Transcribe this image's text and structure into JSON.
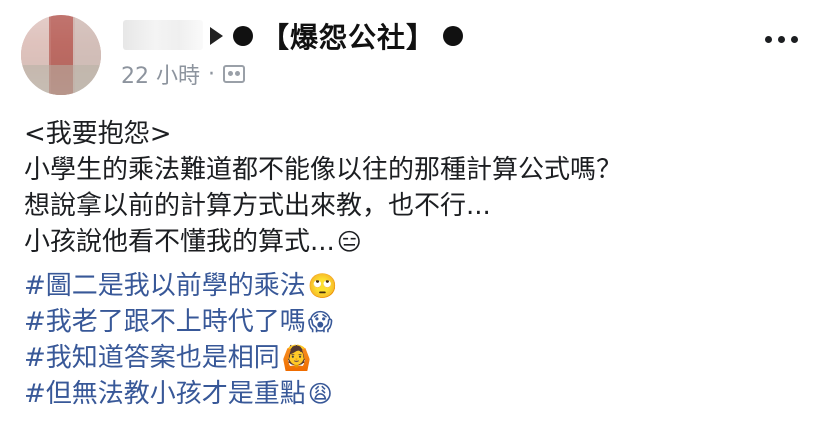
{
  "post": {
    "group_name": "【爆怨公社】",
    "time": "22 小時",
    "separator": "·",
    "privacy_icon": "friends-icon",
    "more_icon": "more-options-icon"
  },
  "content": {
    "lines": [
      "<我要抱怨>",
      "小學生的乘法難道都不能像以往的那種計算公式嗎？",
      "想說拿以前的計算方式出來教，也不行...",
      "小孩說他看不懂我的算式..."
    ],
    "line4_emoji": "😑"
  },
  "hashtags": [
    {
      "text": "#圖二是我以前學的乘法",
      "emoji": "🙄"
    },
    {
      "text": "#我老了跟不上時代了嗎",
      "emoji": "😱"
    },
    {
      "text": "#我知道答案也是相同",
      "emoji": "🙆"
    },
    {
      "text": "#但無法教小孩才是重點",
      "emoji": "😩"
    }
  ]
}
